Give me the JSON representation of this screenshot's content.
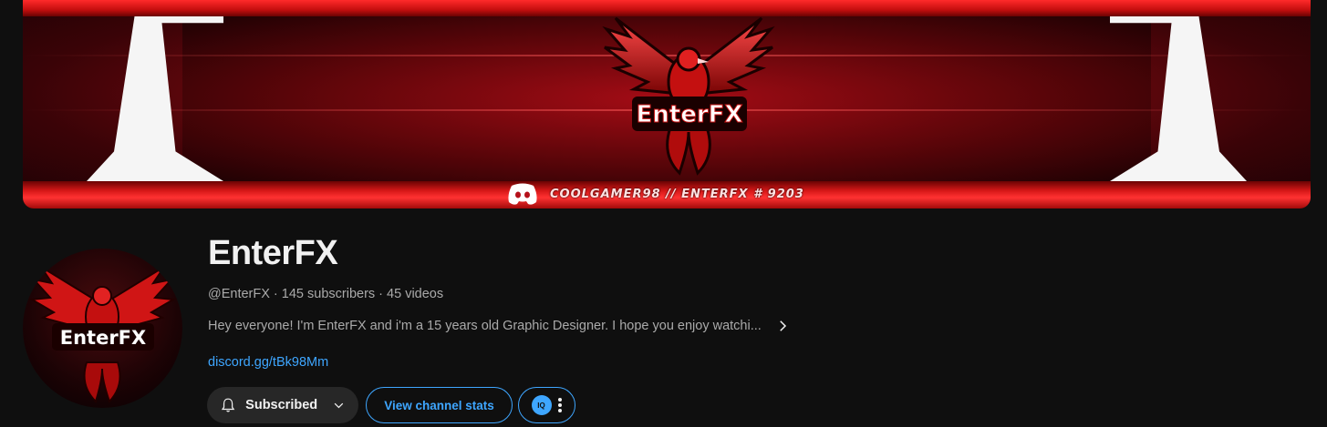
{
  "banner": {
    "logo_text": "EnterFX",
    "discord_text": "COOLGAMER98 // ENTERFX # 9203"
  },
  "avatar": {
    "logo_text": "EnterFX"
  },
  "channel": {
    "name": "EnterFX",
    "meta": "@EnterFX · 145 subscribers · 45 videos",
    "description": "Hey everyone! I'm EnterFX and i'm a 15 years old Graphic Designer. I hope you enjoy watchi...",
    "link": "discord.gg/tBk98Mm"
  },
  "actions": {
    "subscribed_label": "Subscribed",
    "stats_label": "View channel stats",
    "extension_label": "IQ"
  },
  "colors": {
    "accent": "#3ea6ff",
    "background": "#0f0f0f",
    "banner_red": "#b5101a"
  }
}
